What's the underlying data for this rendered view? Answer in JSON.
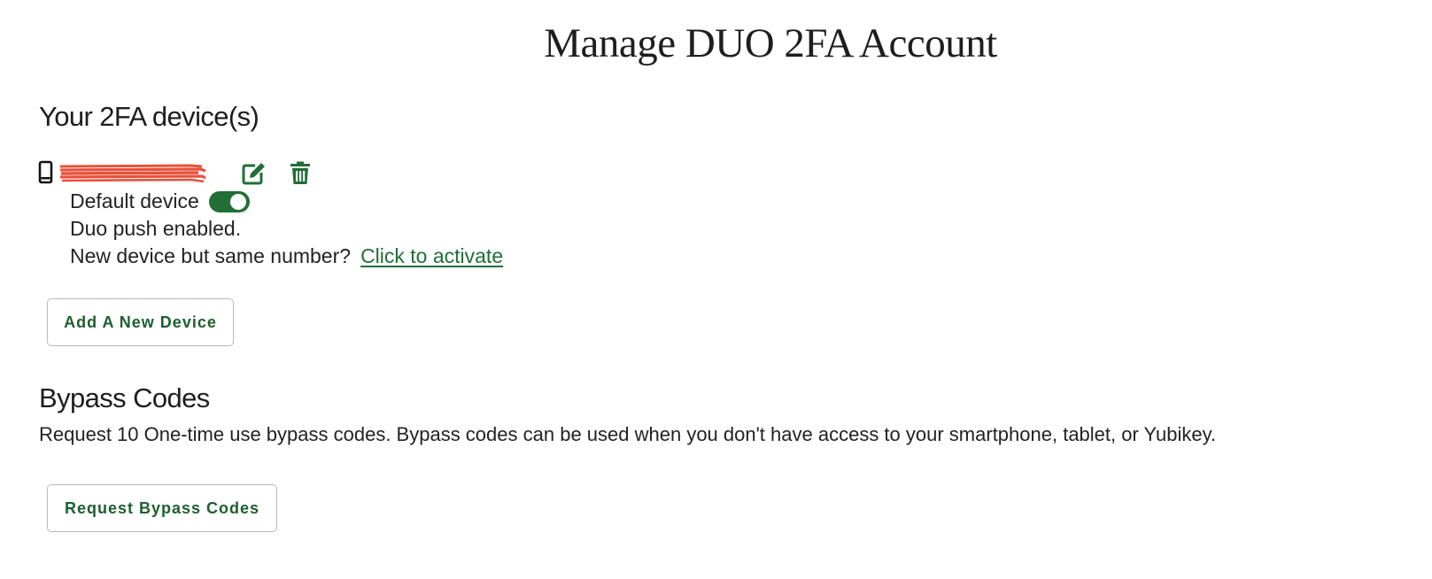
{
  "page": {
    "title": "Manage DUO 2FA Account"
  },
  "devices_section": {
    "heading": "Your 2FA device(s)",
    "device": {
      "icon": "mobile-phone-icon",
      "name_redacted": true,
      "edit_icon": "edit-icon",
      "delete_icon": "trash-icon",
      "default_label": "Default device",
      "default_enabled": true,
      "push_status": "Duo push enabled.",
      "new_device_prompt": "New device but same number?",
      "activate_link": "Click to activate"
    },
    "add_button_label": "Add A New Device"
  },
  "bypass_section": {
    "heading": "Bypass Codes",
    "description": "Request 10 One-time use bypass codes. Bypass codes can be used when you don't have access to your smartphone, tablet, or Yubikey.",
    "button_label": "Request Bypass Codes"
  },
  "colors": {
    "accent": "#216e37",
    "button_text": "#1d5e2e",
    "redaction": "#e8513a"
  }
}
